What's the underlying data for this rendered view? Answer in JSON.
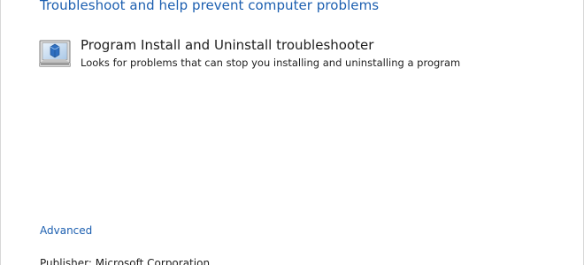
{
  "page": {
    "heading": "Troubleshoot and help prevent computer problems"
  },
  "troubleshooter": {
    "title": "Program Install and Uninstall troubleshooter",
    "description": "Looks for problems that can stop you installing and uninstalling a program",
    "icon": "installer-monitor-icon"
  },
  "links": {
    "advanced": "Advanced"
  },
  "footer": {
    "publisher": "Publisher: Microsoft Corporation"
  },
  "colors": {
    "link": "#1c5fb0",
    "text": "#1e1e1e",
    "background": "#ffffff"
  }
}
